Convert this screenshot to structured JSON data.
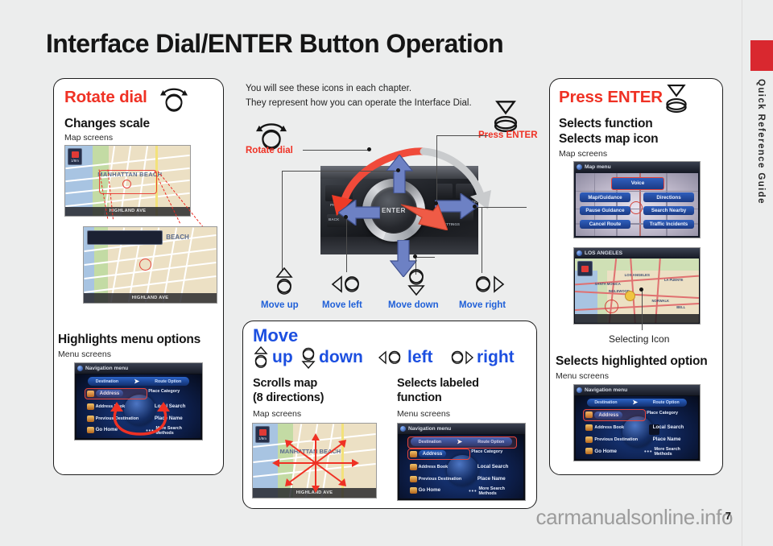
{
  "page": {
    "title": "Interface Dial/ENTER Button Operation",
    "number": "7",
    "side_tab_label": "Quick Reference Guide",
    "watermark": "carmanualsonline.info",
    "accent_red": "#ef3124",
    "accent_blue": "#1c4fe0",
    "tab_red": "#d9282f",
    "background": "#eceded"
  },
  "intro": {
    "line1": "You will see these icons in each chapter.",
    "line2": "They represent how you can operate the Interface Dial."
  },
  "diagram": {
    "rotate_dial_label": "Rotate dial",
    "press_enter_label": "Press ENTER",
    "enter_button_text": "ENTER",
    "hw_labels": [
      "PHONE",
      "INFO",
      "PREV/ AUDIO",
      "BACK",
      "SETTINGS"
    ],
    "move_captions": [
      {
        "label": "Move up",
        "icon": "move-up-icon"
      },
      {
        "label": "Move left",
        "icon": "move-left-icon"
      },
      {
        "label": "Move down",
        "icon": "move-down-icon"
      },
      {
        "label": "Move right",
        "icon": "move-right-icon"
      }
    ]
  },
  "panel_rotate": {
    "heading": "Rotate dial",
    "icon": "rotate-dial-icon",
    "section1": {
      "title": "Changes scale",
      "subtitle": "Map screens"
    },
    "section2": {
      "title": "Highlights menu options",
      "subtitle": "Menu screens"
    },
    "map_top": {
      "city": "MANHATTAN BEACH",
      "street": "HIGHLAND AVE",
      "scale": "1/8m"
    },
    "map_bottom": {
      "city": "BEACH",
      "street": "HIGHLAND AVE"
    },
    "nav_screen": {
      "title": "Navigation menu",
      "tab_left": "Destination",
      "tab_right": "Route Option",
      "items": [
        "Address",
        "Place Category",
        "Address Book",
        "Local Search",
        "Previous Destination",
        "Place Name",
        "Go Home",
        "More Search Methods"
      ],
      "highlighted": "Address"
    }
  },
  "panel_move": {
    "heading": "Move",
    "directions": [
      {
        "label": "up",
        "icon": "move-up-icon"
      },
      {
        "label": "down",
        "icon": "move-down-icon"
      },
      {
        "label": "left",
        "icon": "move-left-icon"
      },
      {
        "label": "right",
        "icon": "move-right-icon"
      }
    ],
    "col_left": {
      "title_l1": "Scrolls map",
      "title_l2": "(8 directions)",
      "subtitle": "Map screens"
    },
    "col_right": {
      "title_l1": "Selects labeled",
      "title_l2": "function",
      "subtitle": "Menu screens"
    },
    "map": {
      "city": "MANHATTAN BEACH",
      "street": "HIGHLAND AVE",
      "scale": "1/8m"
    },
    "nav_screen": {
      "title": "Navigation menu",
      "tab_left": "Destination",
      "tab_right": "Route Option",
      "items": [
        "Address",
        "Place Category",
        "Address Book",
        "Local Search",
        "Previous Destination",
        "Place Name",
        "Go Home",
        "More Search Methods"
      ],
      "highlighted": "Destination / Route Option"
    }
  },
  "panel_enter": {
    "heading": "Press ENTER",
    "icon": "press-enter-icon",
    "section1": {
      "title_l1": "Selects function",
      "title_l2": "Selects map icon",
      "subtitle": "Map screens"
    },
    "section2": {
      "title": "Selects highlighted option",
      "subtitle": "Menu screens"
    },
    "map_menu": {
      "title": "Map menu",
      "highlighted": "Voice",
      "buttons_left": [
        "Map/Guidance",
        "Pause Guidance",
        "Cancel Route"
      ],
      "buttons_right": [
        "Directions",
        "Search Nearby",
        "Traffic Incidents"
      ]
    },
    "la_map": {
      "title": "LOS ANGELES",
      "labels": [
        "LOS ANGELES",
        "SANTA MONICA",
        "INGLEWOOD",
        "NORWALK",
        "LA PUENTE",
        "BELL"
      ],
      "callout": "Selecting Icon"
    },
    "nav_screen": {
      "title": "Navigation menu",
      "tab_left": "Destination",
      "tab_right": "Route Option",
      "items": [
        "Address",
        "Place Category",
        "Address Book",
        "Local Search",
        "Previous Destination",
        "Place Name",
        "Go Home",
        "More Search Methods"
      ],
      "highlighted": "Address"
    }
  }
}
